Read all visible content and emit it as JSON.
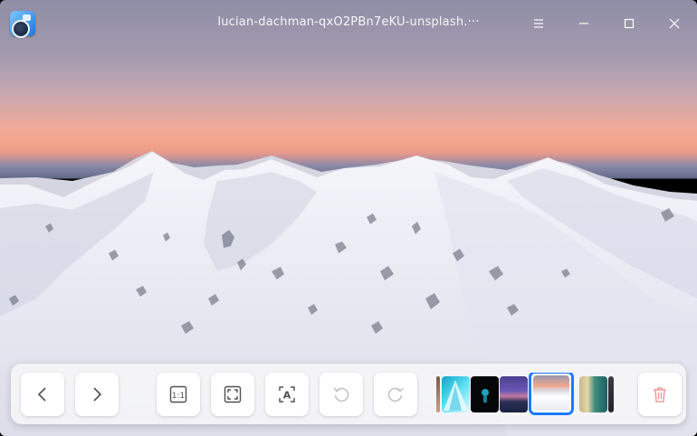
{
  "window": {
    "title": "lucian-dachman-qxO2PBn7eKU-unsplash.···",
    "controls": {
      "menu": "≡",
      "minimize": "—",
      "maximize": "□",
      "close": "✕"
    }
  },
  "toolbar": {
    "buttons": [
      {
        "name": "previous-button",
        "icon": "chevron-left-icon"
      },
      {
        "name": "next-button",
        "icon": "chevron-right-icon"
      },
      {
        "name": "original-size-button",
        "icon": "one-to-one-icon",
        "icon_text": "1:1"
      },
      {
        "name": "fit-to-window-button",
        "icon": "fit-screen-icon"
      },
      {
        "name": "ocr-button",
        "icon": "text-recognition-icon",
        "icon_text": "A"
      },
      {
        "name": "rotate-left-button",
        "icon": "rotate-ccw-icon"
      },
      {
        "name": "rotate-right-button",
        "icon": "rotate-cw-icon"
      },
      {
        "name": "delete-button",
        "icon": "trash-icon"
      }
    ],
    "thumbnails": [
      "partial-left",
      "blue-triangle",
      "dark-figure",
      "purple-landscape",
      "snowy-mountain-active",
      "beach-aerial",
      "partial-right"
    ]
  },
  "colors": {
    "accent": "#1a7bff",
    "delete": "#f28f8f"
  }
}
